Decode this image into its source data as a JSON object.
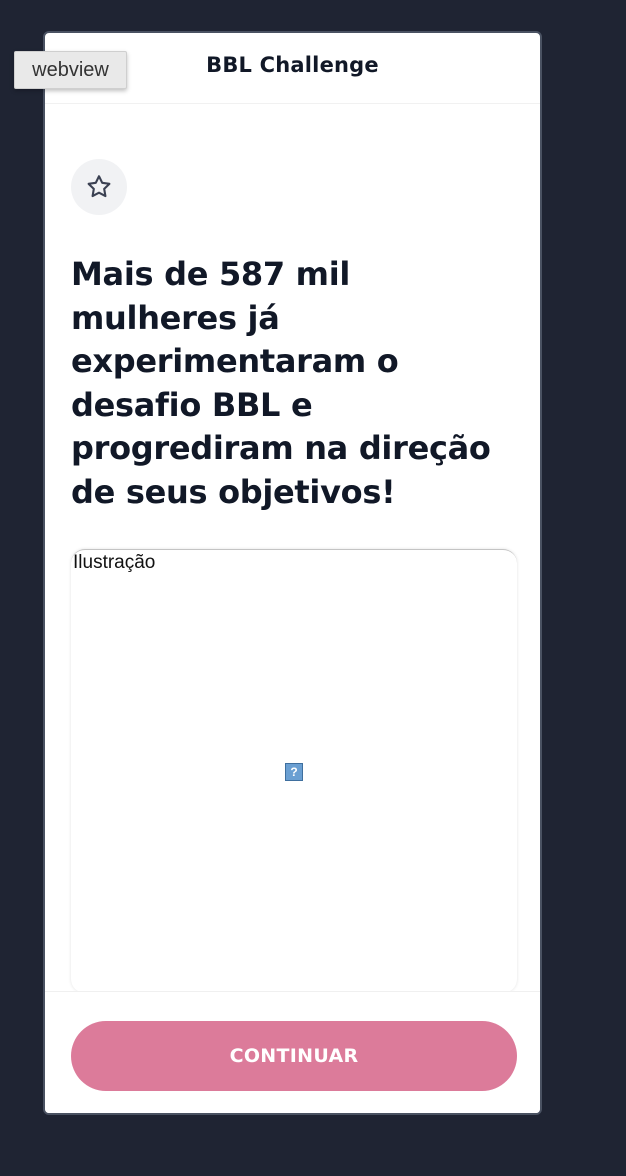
{
  "devtools": {
    "webview_label": "webview"
  },
  "header": {
    "title": "BBL Challenge"
  },
  "badge": {
    "icon": "star-icon"
  },
  "headline": "Mais de 587 mil mulheres já experimentaram o desafio BBL e progrediram na direção de seus objetivos!",
  "illustration": {
    "alt": "Ilustração",
    "broken_icon_glyph": "?"
  },
  "footer": {
    "continue_label": "CONTINUAR"
  },
  "colors": {
    "background": "#1f2433",
    "button": "#dc7b9a",
    "text": "#111827",
    "badge_bg": "#f1f2f4"
  }
}
